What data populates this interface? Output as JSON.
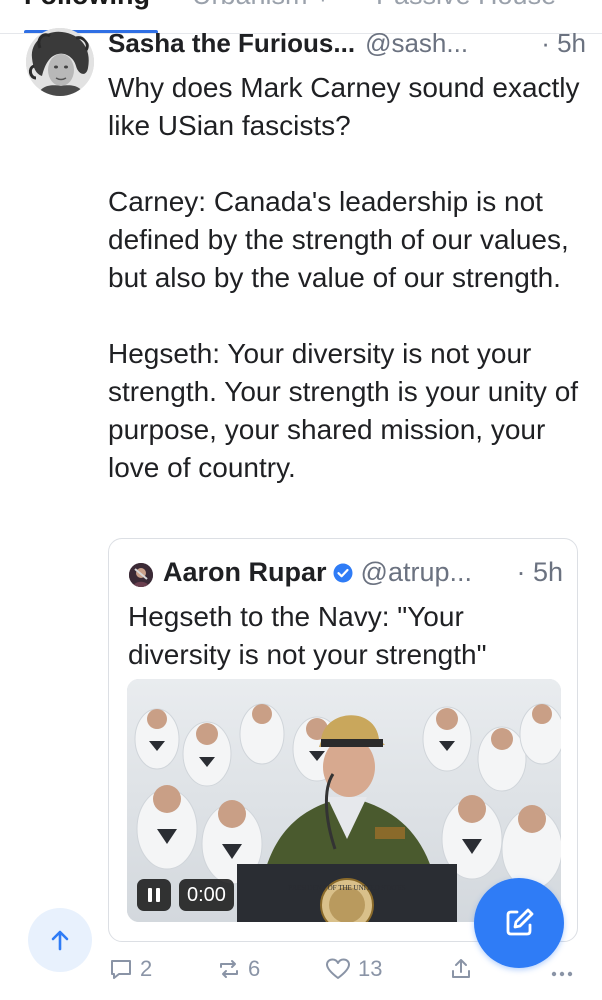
{
  "tabs": [
    {
      "label": "Following",
      "active": true
    },
    {
      "label": "Urbanism +",
      "active": false
    },
    {
      "label": "Passive House",
      "active": false
    }
  ],
  "post": {
    "author_name": "Sasha the Furious...",
    "author_handle": "@sash...",
    "time": "· 5h",
    "paragraphs": [
      "Why does Mark Carney sound exactly like USian fascists?",
      "Carney: Canada's leadership is not defined by the strength of our values, but also by the value of our strength.",
      "Hegseth: Your diversity is not your strength. Your strength is your unity of purpose, your shared mission, your love of country."
    ],
    "quote": {
      "author_name": "Aaron Rupar",
      "author_handle": "@atrup...",
      "time": "· 5h",
      "text": "Hegseth to the Navy: \"Your diversity is not your strength\"",
      "video": {
        "time": "0:00",
        "podium_text": "PRESIDENT OF THE UNITED STATES"
      }
    },
    "actions": {
      "replies": "2",
      "reposts": "6",
      "likes": "13",
      "share_icon": "share-icon",
      "more_icon": "more-icon"
    }
  },
  "icons": {
    "scroll_top": "arrow-up-icon",
    "compose": "compose-icon",
    "verified": "verified-badge-icon"
  },
  "colors": {
    "accent": "#2f7cf6",
    "tab_indicator": "#2f6fe4",
    "muted": "#6b7280",
    "action_gray": "#8a94a6",
    "scroll_top_bg": "#e8f1fd"
  }
}
